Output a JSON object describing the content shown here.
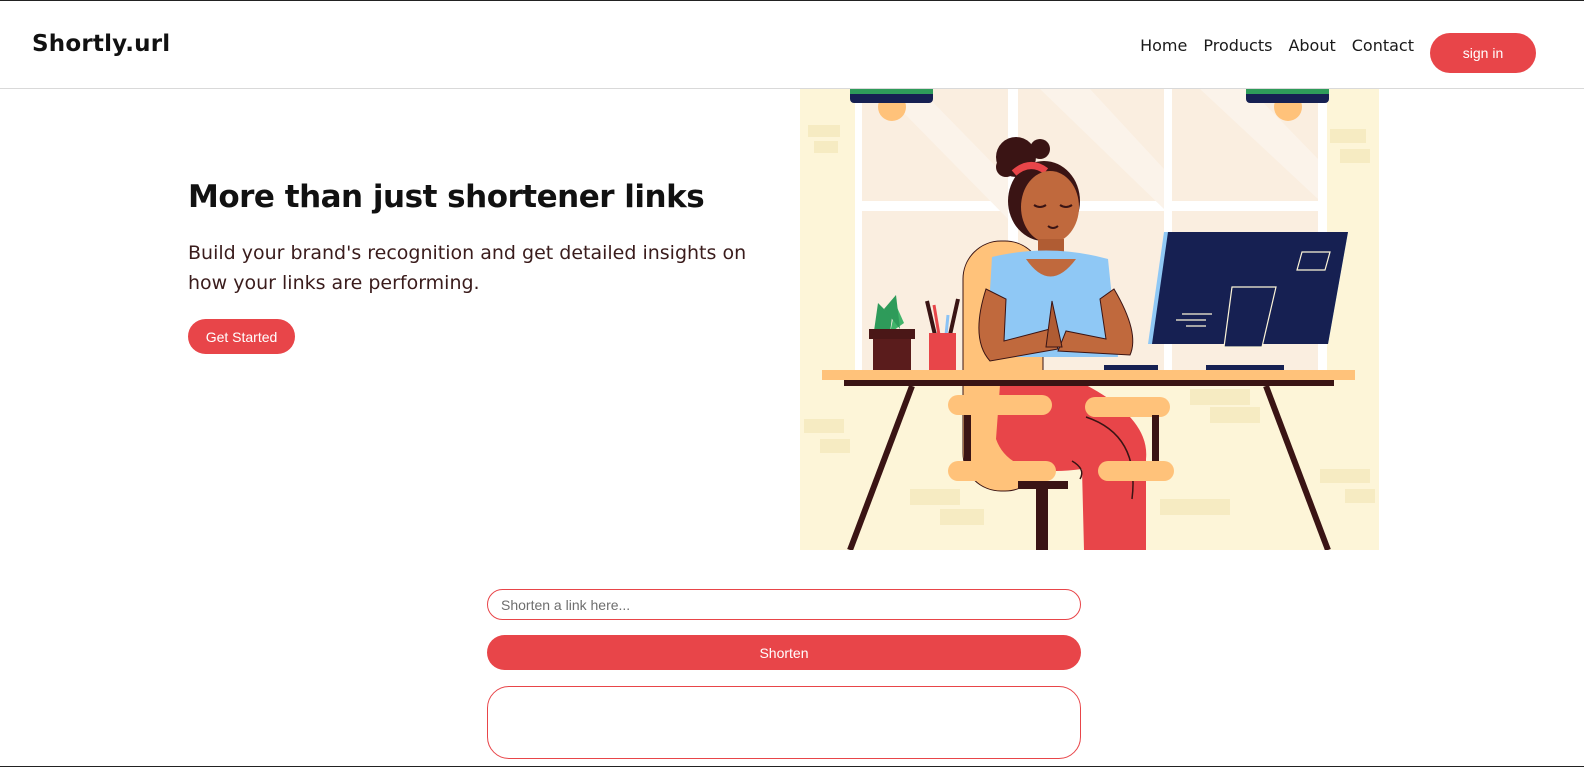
{
  "brand": {
    "logo": "Shortly.url",
    "accent_color": "#e84549"
  },
  "nav": {
    "items": [
      {
        "label": "Home"
      },
      {
        "label": "Products"
      },
      {
        "label": "About"
      },
      {
        "label": "Contact"
      }
    ],
    "signin_label": "sign in"
  },
  "hero": {
    "title": "More than just shortener links",
    "subtitle": "Build your brand's recognition and get detailed insights on how your links are performing.",
    "cta_label": "Get Started"
  },
  "shortener": {
    "input_placeholder": "Shorten a link here...",
    "input_value": "",
    "button_label": "Shorten",
    "result": ""
  }
}
